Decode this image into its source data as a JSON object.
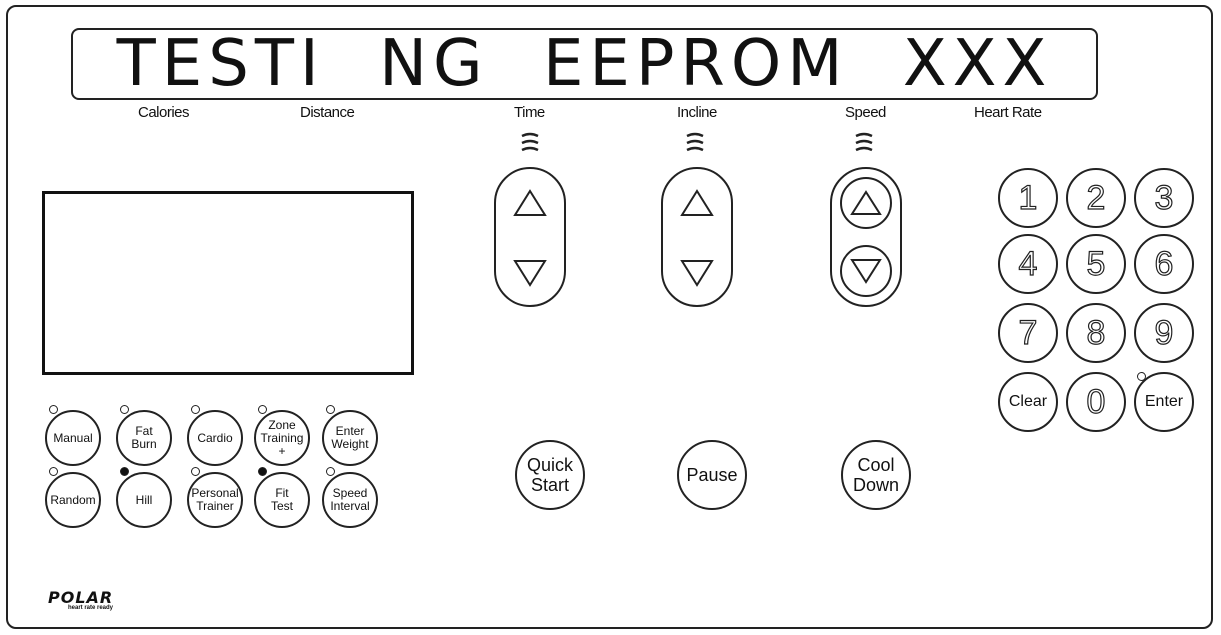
{
  "display": {
    "text": "TESTI NG EEPROM XXX"
  },
  "labels": {
    "calories": "Calories",
    "distance": "Distance",
    "time": "Time",
    "incline": "Incline",
    "speed": "Speed",
    "heart_rate": "Heart Rate"
  },
  "programs": [
    {
      "label": "Manual",
      "led": "off"
    },
    {
      "label": "Fat\nBurn",
      "led": "off"
    },
    {
      "label": "Cardio",
      "led": "off"
    },
    {
      "label": "Zone\nTraining\n+",
      "led": "off"
    },
    {
      "label": "Enter\nWeight",
      "led": "off"
    },
    {
      "label": "Random",
      "led": "off"
    },
    {
      "label": "Hill",
      "led": "on"
    },
    {
      "label": "Personal\nTrainer",
      "led": "off"
    },
    {
      "label": "Fit\nTest",
      "led": "on"
    },
    {
      "label": "Speed\nInterval",
      "led": "off"
    }
  ],
  "controls": {
    "quick_start": "Quick\nStart",
    "pause": "Pause",
    "cool_down": "Cool\nDown"
  },
  "keypad": [
    "1",
    "2",
    "3",
    "4",
    "5",
    "6",
    "7",
    "8",
    "9",
    "Clear",
    "0",
    "Enter"
  ],
  "enter_led": "off",
  "logo": {
    "brand": "POLAR",
    "tagline": "heart rate ready"
  },
  "icons": {
    "arrow_up": "triangle-up-icon",
    "arrow_down": "triangle-down-icon",
    "waves": "signal-waves-icon"
  }
}
